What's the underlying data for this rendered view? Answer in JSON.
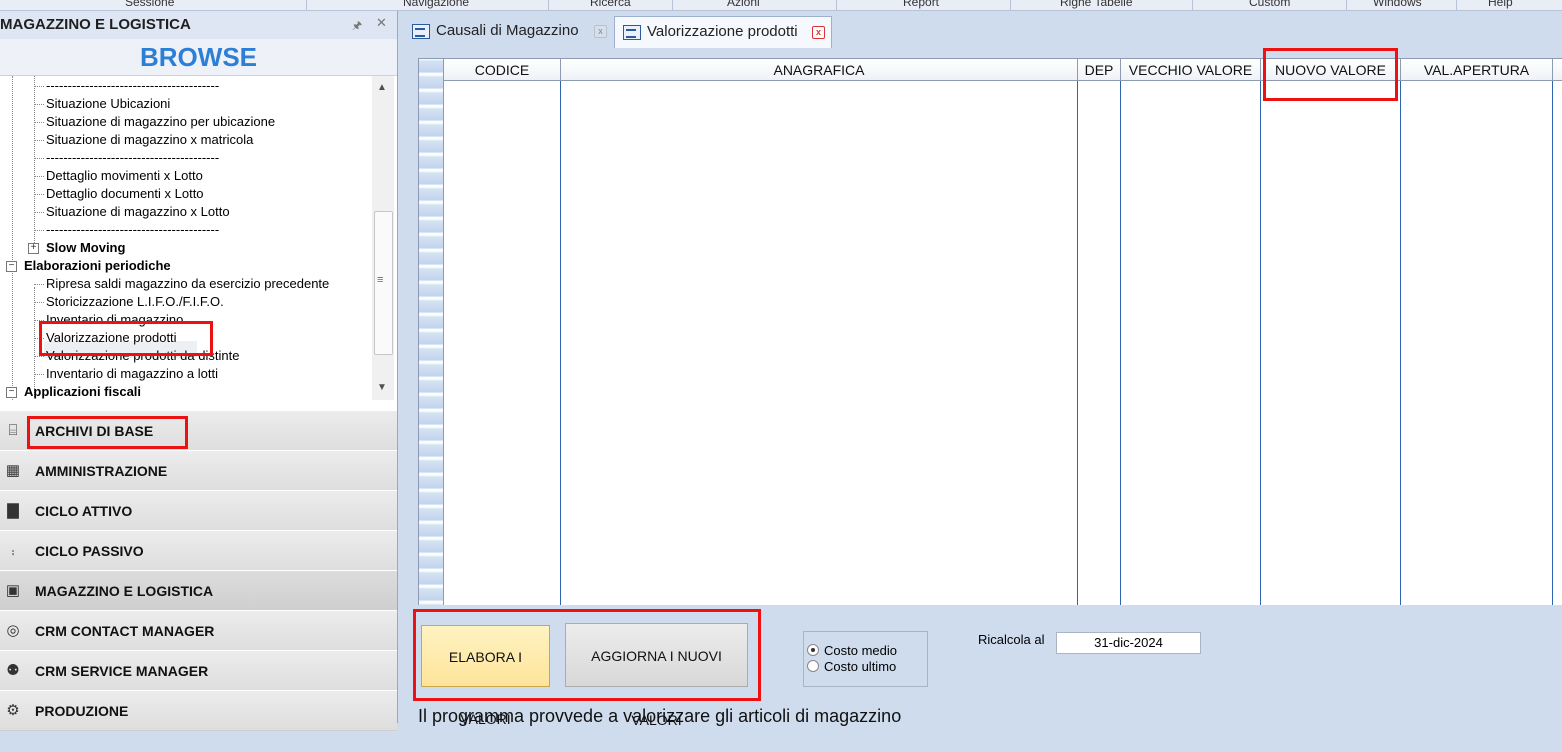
{
  "menubar": [
    "Sessione",
    "Navigazione",
    "Ricerca",
    "Azioni",
    "Report",
    "Righe Tabelle",
    "Custom",
    "Windows",
    "Help"
  ],
  "left_panel": {
    "title": "MAGAZZINO E LOGISTICA",
    "browse": "BROWSE",
    "tree": {
      "separator": "----------------------------------------",
      "situazione_ubicazioni": "Situazione Ubicazioni",
      "situazione_per_ubicazione": "Situazione di magazzino per ubicazione",
      "situazione_x_matricola": "Situazione di magazzino x matricola",
      "dettaglio_movimenti_lotto": "Dettaglio movimenti x Lotto",
      "dettaglio_documenti_lotto": "Dettaglio documenti x Lotto",
      "situazione_x_lotto": "Situazione di magazzino x Lotto",
      "slow_moving": "Slow Moving",
      "elaborazioni_periodiche": "Elaborazioni periodiche",
      "ripresa_saldi": "Ripresa saldi magazzino da esercizio precedente",
      "storicizzazione": "Storicizzazione L.I.F.O./F.I.F.O.",
      "inventario": "Inventario di magazzino",
      "valorizzazione_prodotti": "Valorizzazione prodotti",
      "valorizzazione_distinte": "Valorizzazione prodotti da distinte",
      "inventario_lotti": "Inventario di magazzino a lotti",
      "applicazioni_fiscali": "Applicazioni fiscali"
    },
    "nav": [
      {
        "label": "ARCHIVI DI BASE",
        "icon": "server-icon"
      },
      {
        "label": "AMMINISTRAZIONE",
        "icon": "calculator-icon"
      },
      {
        "label": "CICLO ATTIVO",
        "icon": "bar-chart-icon"
      },
      {
        "label": "CICLO PASSIVO",
        "icon": "cart-icon"
      },
      {
        "label": "MAGAZZINO E LOGISTICA",
        "icon": "forklift-icon"
      },
      {
        "label": "CRM CONTACT MANAGER",
        "icon": "globe-icon"
      },
      {
        "label": "CRM SERVICE MANAGER",
        "icon": "users-icon"
      },
      {
        "label": "PRODUZIONE",
        "icon": "gear-icon"
      }
    ]
  },
  "tabs": [
    {
      "label": "Causali di Magazzino",
      "close": "x"
    },
    {
      "label": "Valorizzazione prodotti",
      "close": "x"
    }
  ],
  "grid": {
    "columns": [
      "CODICE",
      "ANAGRAFICA",
      "DEP",
      "VECCHIO VALORE",
      "NUOVO VALORE",
      "VAL.APERTURA"
    ]
  },
  "actions": {
    "elabora": "ELABORA I VALORI",
    "aggiorna": "AGGIORNA I NUOVI VALORI",
    "costo_medio": "Costo medio",
    "costo_ultimo": "Costo ultimo",
    "ricalcola_label": "Ricalcola al",
    "ricalcola_date": "31-dic-2024",
    "description": "Il programma provvede a valorizzare gli articoli di magazzino"
  },
  "colors": {
    "highlight": "#ee1111",
    "browse": "#2b7fd6",
    "elabora_bg": "#fde49a"
  }
}
